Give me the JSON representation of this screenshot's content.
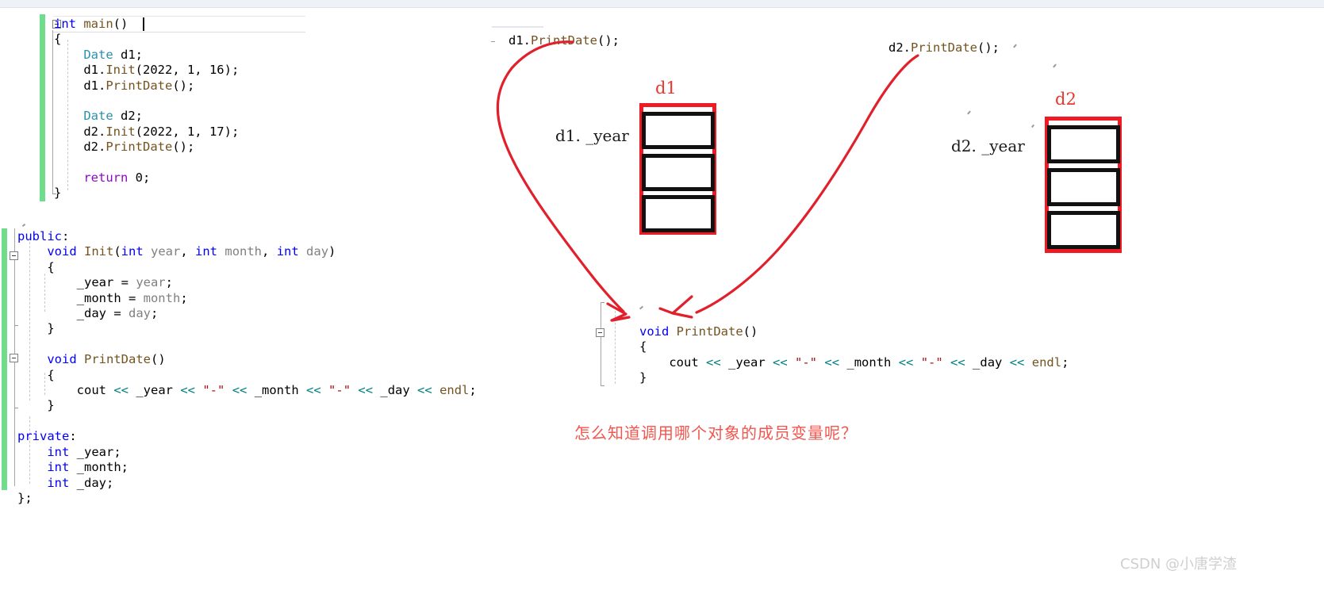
{
  "colors": {
    "keyword": "#0000ff",
    "type": "#2b91af",
    "function": "#74531f",
    "parameter": "#808080",
    "string": "#a31515",
    "stream_operator": "#008080",
    "annotation_red": "#ee1b24",
    "note_red": "#f2564f",
    "change_bar_green": "#6fdd8b",
    "watermark_gray": "#cfcfcf"
  },
  "main_editor": {
    "lines": [
      {
        "tokens": [
          {
            "t": "int",
            "c": "kw"
          },
          {
            "t": " ",
            "c": "op"
          },
          {
            "t": "main",
            "c": "fn"
          },
          {
            "t": "()",
            "c": "op"
          }
        ]
      },
      {
        "tokens": [
          {
            "t": "{",
            "c": "op"
          }
        ]
      },
      {
        "tokens": [
          {
            "t": "    Date",
            "c": "type"
          },
          {
            "t": " d1;",
            "c": "id"
          }
        ]
      },
      {
        "tokens": [
          {
            "t": "    d1.",
            "c": "id"
          },
          {
            "t": "Init",
            "c": "fn"
          },
          {
            "t": "(2022, 1, 16);",
            "c": "id"
          }
        ]
      },
      {
        "tokens": [
          {
            "t": "    d1.",
            "c": "id"
          },
          {
            "t": "PrintDate",
            "c": "fn"
          },
          {
            "t": "();",
            "c": "id"
          }
        ]
      },
      {
        "tokens": []
      },
      {
        "tokens": [
          {
            "t": "    Date",
            "c": "type"
          },
          {
            "t": " d2;",
            "c": "id"
          }
        ]
      },
      {
        "tokens": [
          {
            "t": "    d2.",
            "c": "id"
          },
          {
            "t": "Init",
            "c": "fn"
          },
          {
            "t": "(2022, 1, 17);",
            "c": "id"
          }
        ]
      },
      {
        "tokens": [
          {
            "t": "    d2.",
            "c": "id"
          },
          {
            "t": "PrintDate",
            "c": "fn"
          },
          {
            "t": "();",
            "c": "id"
          }
        ]
      },
      {
        "tokens": []
      },
      {
        "tokens": [
          {
            "t": "    return",
            "c": "kwret"
          },
          {
            "t": " 0;",
            "c": "id"
          }
        ]
      },
      {
        "tokens": [
          {
            "t": "}",
            "c": "op"
          }
        ]
      }
    ]
  },
  "class_editor": {
    "lines": [
      {
        "tokens": [
          {
            "t": "public",
            "c": "kw"
          },
          {
            "t": ":",
            "c": "op"
          }
        ]
      },
      {
        "tokens": [
          {
            "t": "    void",
            "c": "kw"
          },
          {
            "t": " ",
            "c": "op"
          },
          {
            "t": "Init",
            "c": "fn"
          },
          {
            "t": "(",
            "c": "op"
          },
          {
            "t": "int",
            "c": "kw"
          },
          {
            "t": " ",
            "c": "op"
          },
          {
            "t": "year",
            "c": "param"
          },
          {
            "t": ", ",
            "c": "op"
          },
          {
            "t": "int",
            "c": "kw"
          },
          {
            "t": " ",
            "c": "op"
          },
          {
            "t": "month",
            "c": "param"
          },
          {
            "t": ", ",
            "c": "op"
          },
          {
            "t": "int",
            "c": "kw"
          },
          {
            "t": " ",
            "c": "op"
          },
          {
            "t": "day",
            "c": "param"
          },
          {
            "t": ")",
            "c": "op"
          }
        ]
      },
      {
        "tokens": [
          {
            "t": "    {",
            "c": "op"
          }
        ]
      },
      {
        "tokens": [
          {
            "t": "        _year = ",
            "c": "id"
          },
          {
            "t": "year",
            "c": "param"
          },
          {
            "t": ";",
            "c": "op"
          }
        ]
      },
      {
        "tokens": [
          {
            "t": "        _month = ",
            "c": "id"
          },
          {
            "t": "month",
            "c": "param"
          },
          {
            "t": ";",
            "c": "op"
          }
        ]
      },
      {
        "tokens": [
          {
            "t": "        _day = ",
            "c": "id"
          },
          {
            "t": "day",
            "c": "param"
          },
          {
            "t": ";",
            "c": "op"
          }
        ]
      },
      {
        "tokens": [
          {
            "t": "    }",
            "c": "op"
          }
        ]
      },
      {
        "tokens": []
      },
      {
        "tokens": [
          {
            "t": "    void",
            "c": "kw"
          },
          {
            "t": " ",
            "c": "op"
          },
          {
            "t": "PrintDate",
            "c": "fn"
          },
          {
            "t": "()",
            "c": "op"
          }
        ]
      },
      {
        "tokens": [
          {
            "t": "    {",
            "c": "op"
          }
        ]
      },
      {
        "tokens": [
          {
            "t": "        cout ",
            "c": "id"
          },
          {
            "t": "<<",
            "c": "shift"
          },
          {
            "t": " _year ",
            "c": "id"
          },
          {
            "t": "<<",
            "c": "shift"
          },
          {
            "t": " ",
            "c": "op"
          },
          {
            "t": "\"-\"",
            "c": "str"
          },
          {
            "t": " ",
            "c": "op"
          },
          {
            "t": "<<",
            "c": "shift"
          },
          {
            "t": " _month ",
            "c": "id"
          },
          {
            "t": "<<",
            "c": "shift"
          },
          {
            "t": " ",
            "c": "op"
          },
          {
            "t": "\"-\"",
            "c": "str"
          },
          {
            "t": " ",
            "c": "op"
          },
          {
            "t": "<<",
            "c": "shift"
          },
          {
            "t": " _day ",
            "c": "id"
          },
          {
            "t": "<<",
            "c": "shift"
          },
          {
            "t": " ",
            "c": "op"
          },
          {
            "t": "endl",
            "c": "fn"
          },
          {
            "t": ";",
            "c": "op"
          }
        ]
      },
      {
        "tokens": [
          {
            "t": "    }",
            "c": "op"
          }
        ]
      },
      {
        "tokens": []
      },
      {
        "tokens": [
          {
            "t": "private",
            "c": "kw"
          },
          {
            "t": ":",
            "c": "op"
          }
        ]
      },
      {
        "tokens": [
          {
            "t": "    int",
            "c": "kw"
          },
          {
            "t": " _year;",
            "c": "id"
          }
        ]
      },
      {
        "tokens": [
          {
            "t": "    int",
            "c": "kw"
          },
          {
            "t": " _month;",
            "c": "id"
          }
        ]
      },
      {
        "tokens": [
          {
            "t": "    int",
            "c": "kw"
          },
          {
            "t": " _day;",
            "c": "id"
          }
        ]
      },
      {
        "tokens": [
          {
            "t": "};",
            "c": "op"
          }
        ]
      }
    ]
  },
  "callout_d1": {
    "code_line": {
      "tokens": [
        {
          "t": "d1.",
          "c": "id"
        },
        {
          "t": "PrintDate",
          "c": "fn"
        },
        {
          "t": "();",
          "c": "id"
        }
      ]
    },
    "box_title": "d1",
    "member_label": "d1. _year",
    "cells": [
      "",
      "",
      ""
    ]
  },
  "callout_d2": {
    "code_line": {
      "tokens": [
        {
          "t": "d2.",
          "c": "id"
        },
        {
          "t": "PrintDate",
          "c": "fn"
        },
        {
          "t": "();",
          "c": "id"
        }
      ]
    },
    "box_title": "d2",
    "member_label": "d2. _year",
    "cells": [
      "",
      "",
      ""
    ]
  },
  "shared_method": {
    "lines": [
      {
        "tokens": [
          {
            "t": "void",
            "c": "kw"
          },
          {
            "t": " ",
            "c": "op"
          },
          {
            "t": "PrintDate",
            "c": "fn"
          },
          {
            "t": "()",
            "c": "op"
          }
        ]
      },
      {
        "tokens": [
          {
            "t": "{",
            "c": "op"
          }
        ]
      },
      {
        "tokens": [
          {
            "t": "    cout ",
            "c": "id"
          },
          {
            "t": "<<",
            "c": "shift"
          },
          {
            "t": " _year ",
            "c": "id"
          },
          {
            "t": "<<",
            "c": "shift"
          },
          {
            "t": " ",
            "c": "op"
          },
          {
            "t": "\"-\"",
            "c": "str"
          },
          {
            "t": " ",
            "c": "op"
          },
          {
            "t": "<<",
            "c": "shift"
          },
          {
            "t": " _month ",
            "c": "id"
          },
          {
            "t": "<<",
            "c": "shift"
          },
          {
            "t": " ",
            "c": "op"
          },
          {
            "t": "\"-\"",
            "c": "str"
          },
          {
            "t": " ",
            "c": "op"
          },
          {
            "t": "<<",
            "c": "shift"
          },
          {
            "t": " _day ",
            "c": "id"
          },
          {
            "t": "<<",
            "c": "shift"
          },
          {
            "t": " ",
            "c": "op"
          },
          {
            "t": "endl",
            "c": "fn"
          },
          {
            "t": ";",
            "c": "op"
          }
        ]
      },
      {
        "tokens": [
          {
            "t": "}",
            "c": "op"
          }
        ]
      }
    ]
  },
  "note": {
    "text": "怎么知道调用哪个对象的成员变量呢？"
  },
  "watermark": {
    "text": "CSDN @小唐学渣"
  }
}
